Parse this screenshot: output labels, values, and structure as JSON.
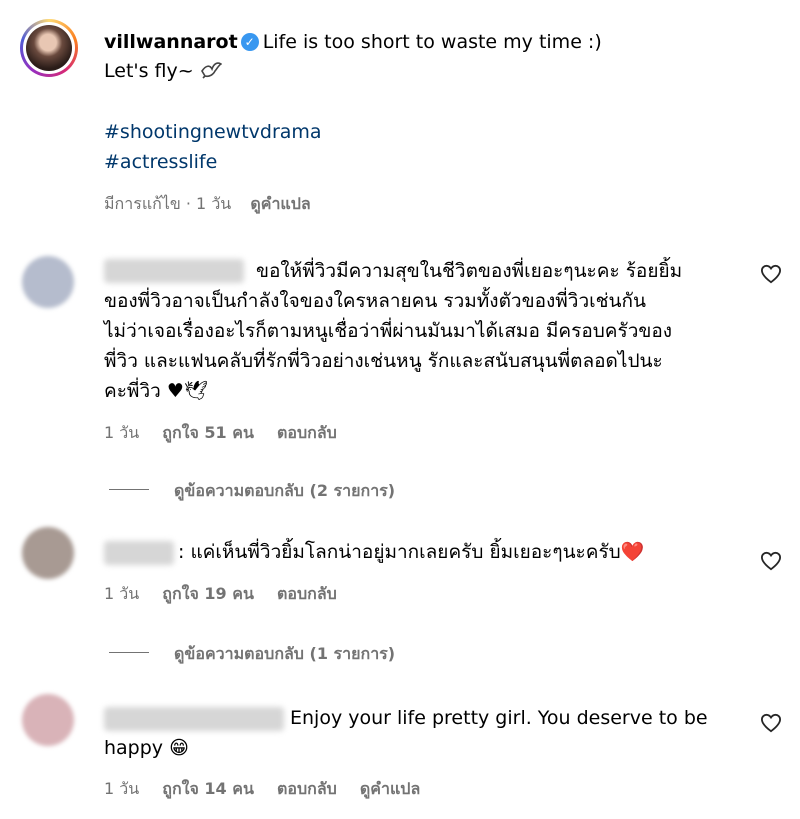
{
  "caption": {
    "username": "villwannarot",
    "line1": "Life is too short to waste my time :)",
    "line2": "Let's fly~",
    "hashtags": [
      "#shootingnewtvdrama",
      "#actresslife"
    ],
    "edited": "มีการแก้ไข · 1 วัน",
    "translate": "ดูคำแปล"
  },
  "comments": [
    {
      "lines": [
        "ขอให้พี่วิวมีความสุขในชีวิตของพี่เยอะๆนะคะ ร้อยยิ้ม",
        "ของพี่วิวอาจเป็นกำลังใจของใครหลายคน รวมทั้งตัวของพี่วิวเช่นกัน",
        "ไม่ว่าเจอเรื่องอะไรก็ตามหนูเชื่อว่าพี่ผ่านมันมาได้เสมอ มีครอบครัวของ",
        "พี่วิว และแฟนคลับที่รักพี่วิวอย่างเช่นหนู รักและสนับสนุนพี่ตลอดไปนะ",
        "คะพี่วิว ♥🕊"
      ],
      "time": "1 วัน",
      "likes": "ถูกใจ 51 คน",
      "reply": "ตอบกลับ",
      "view_replies": "ดูข้อความตอบกลับ (2 รายการ)"
    },
    {
      "lines": [
        ": แค่เห็นพี่วิวยิ้มโลกน่าอยู่มากเลยครับ ยิ้มเยอะๆนะครับ❤️"
      ],
      "time": "1 วัน",
      "likes": "ถูกใจ 19 คน",
      "reply": "ตอบกลับ",
      "view_replies": "ดูข้อความตอบกลับ (1 รายการ)"
    },
    {
      "lines": [
        "Enjoy your life pretty girl. You deserve to be",
        "happy 😁"
      ],
      "time": "1 วัน",
      "likes": "ถูกใจ 14 คน",
      "reply": "ตอบกลับ",
      "translate": "ดูคำแปล"
    }
  ],
  "colors": {
    "link": "#00376b",
    "meta": "#737373",
    "verified": "#3897f0"
  }
}
